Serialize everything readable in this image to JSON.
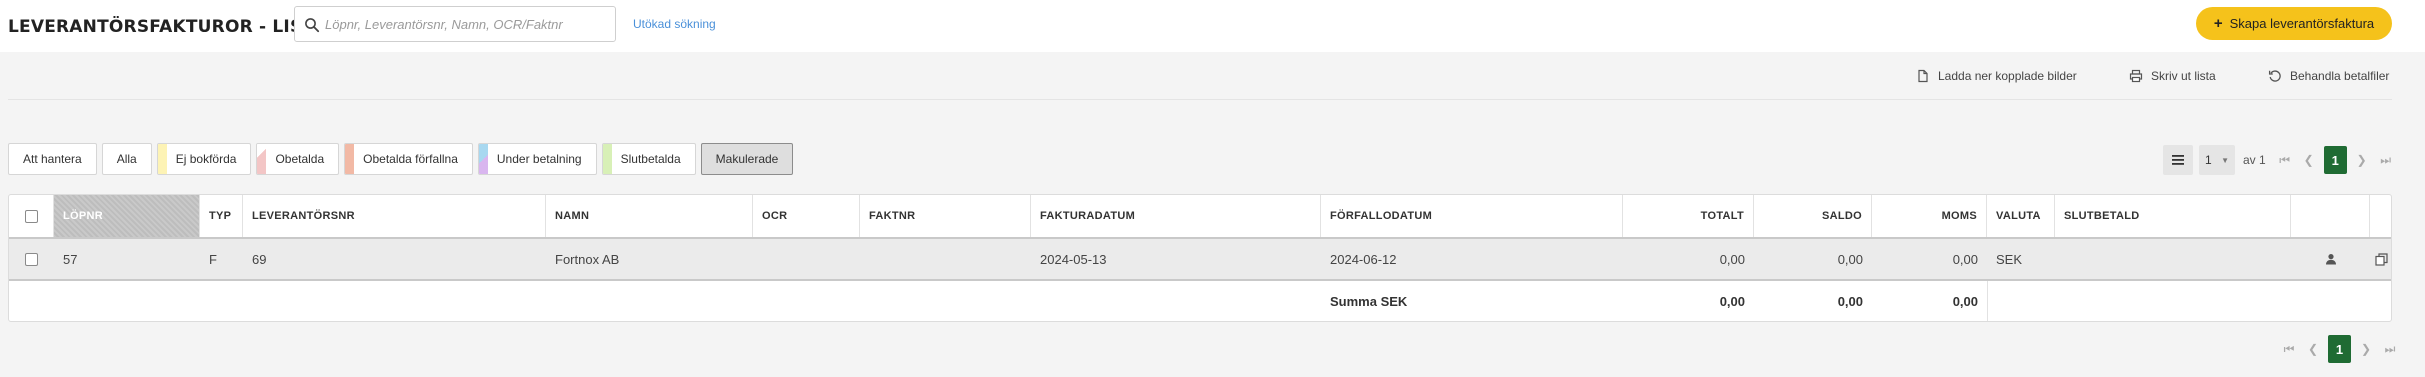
{
  "header": {
    "title": "LEVERANTÖRSFAKTUROR - LISTA",
    "search_placeholder": "Löpnr, Leverantörsnr, Namn, OCR/Faktnr",
    "search_value": "",
    "advanced_search": "Utökad sökning",
    "create_button": "Skapa leverantörsfaktura"
  },
  "toolbar": {
    "download_images": "Ladda ner kopplade bilder",
    "print_list": "Skriv ut lista",
    "process_payments": "Behandla betalfiler"
  },
  "filters": [
    {
      "label": "Att hantera",
      "color": "",
      "active": false
    },
    {
      "label": "Alla",
      "color": "",
      "active": false
    },
    {
      "label": "Ej bokförda",
      "color": "#fdf3b5",
      "active": false
    },
    {
      "label": "Obetalda",
      "color": "#f3c6c6",
      "active": false
    },
    {
      "label": "Obetalda förfallna",
      "color": "#f2b9a5",
      "active": false
    },
    {
      "label": "Under betalning",
      "color": "#c2c6f4",
      "active": false
    },
    {
      "label": "Slutbetalda",
      "color": "#d8f0b7",
      "active": false
    },
    {
      "label": "Makulerade",
      "color": "",
      "active": true
    }
  ],
  "pagination": {
    "page": "1",
    "of_label": "av 1",
    "current": "1"
  },
  "table": {
    "columns": {
      "lopnr": "LÖPNR",
      "typ": "TYP",
      "leverantorsnr": "LEVERANTÖRSNR",
      "namn": "NAMN",
      "ocr": "OCR",
      "faktnr": "FAKTNR",
      "fakturadatum": "FAKTURADATUM",
      "forfallodatum": "FÖRFALLODATUM",
      "totalt": "TOTALT",
      "saldo": "SALDO",
      "moms": "MOMS",
      "valuta": "VALUTA",
      "slutbetald": "SLUTBETALD"
    },
    "rows": [
      {
        "lopnr": "57",
        "typ": "F",
        "leverantorsnr": "69",
        "namn": "Fortnox AB",
        "ocr": "",
        "faktnr": "",
        "fakturadatum": "2024-05-13",
        "forfallodatum": "2024-06-12",
        "totalt": "0,00",
        "saldo": "0,00",
        "moms": "0,00",
        "valuta": "SEK",
        "slutbetald": ""
      }
    ],
    "summary": {
      "label": "Summa SEK",
      "totalt": "0,00",
      "saldo": "0,00",
      "moms": "0,00"
    }
  },
  "icons": [
    "search-icon",
    "file-icon",
    "printer-icon",
    "refresh-icon",
    "list-icon",
    "user-icon",
    "copy-icon",
    "first-page-icon",
    "prev-page-icon",
    "next-page-icon",
    "last-page-icon"
  ]
}
